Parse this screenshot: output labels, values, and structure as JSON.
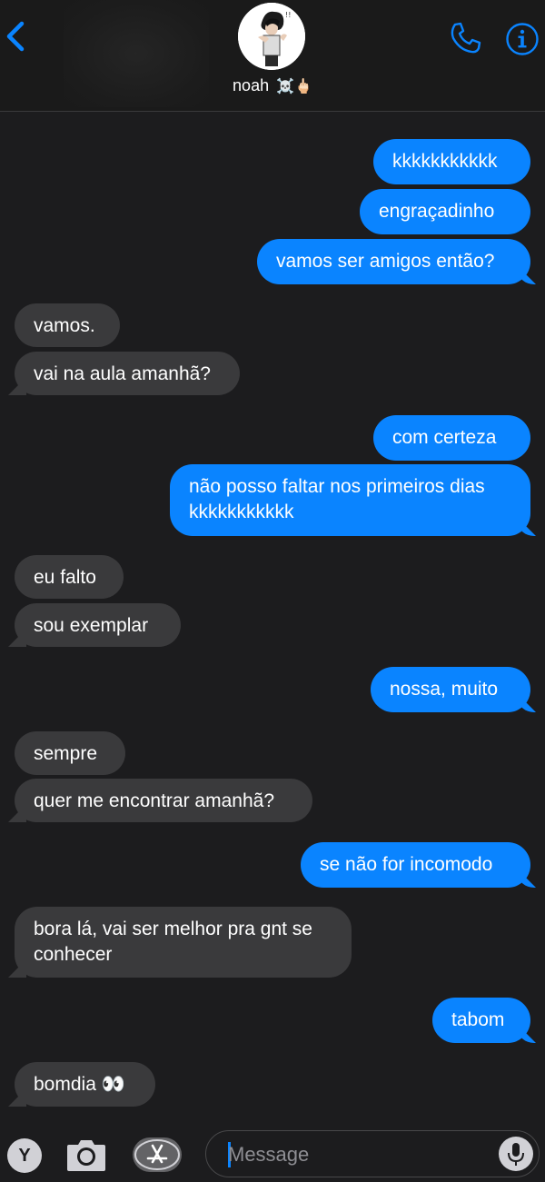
{
  "header": {
    "contact_name": "noah",
    "contact_emoji": "☠️🖕🏻",
    "back_icon": "chevron-left-icon",
    "call_icon": "phone-icon",
    "info_icon": "info-icon",
    "accent_color": "#0a84ff"
  },
  "messages": [
    {
      "side": "sent",
      "text": "kkkkkkkkkkk"
    },
    {
      "side": "sent",
      "text": "engraçadinho"
    },
    {
      "side": "sent",
      "text": "vamos ser amigos então?"
    },
    {
      "side": "received",
      "text": "vamos."
    },
    {
      "side": "received",
      "text": "vai na aula amanhã?"
    },
    {
      "side": "sent",
      "text": "com certeza"
    },
    {
      "side": "sent",
      "text": "não posso faltar nos primeiros dias\nkkkkkkkkkkk"
    },
    {
      "side": "received",
      "text": "eu falto"
    },
    {
      "side": "received",
      "text": "sou exemplar"
    },
    {
      "side": "sent",
      "text": "nossa, muito"
    },
    {
      "side": "received",
      "text": "sempre"
    },
    {
      "side": "received",
      "text": "quer me encontrar amanhã?"
    },
    {
      "side": "sent",
      "text": "se não for incomodo"
    },
    {
      "side": "received",
      "text": "bora lá, vai ser melhor pra gnt se\nconhecer"
    },
    {
      "side": "sent",
      "text": "tabom"
    },
    {
      "side": "received",
      "text": "bomdia 👀"
    }
  ],
  "composer": {
    "app_button_letter": "Y",
    "camera_icon": "camera-icon",
    "appstore_icon": "app-store-icon",
    "placeholder": "Message",
    "mic_icon": "microphone-icon"
  },
  "colors": {
    "sent_bubble": "#0a84ff",
    "received_bubble": "#3a3a3c",
    "background": "#1c1c1e"
  }
}
